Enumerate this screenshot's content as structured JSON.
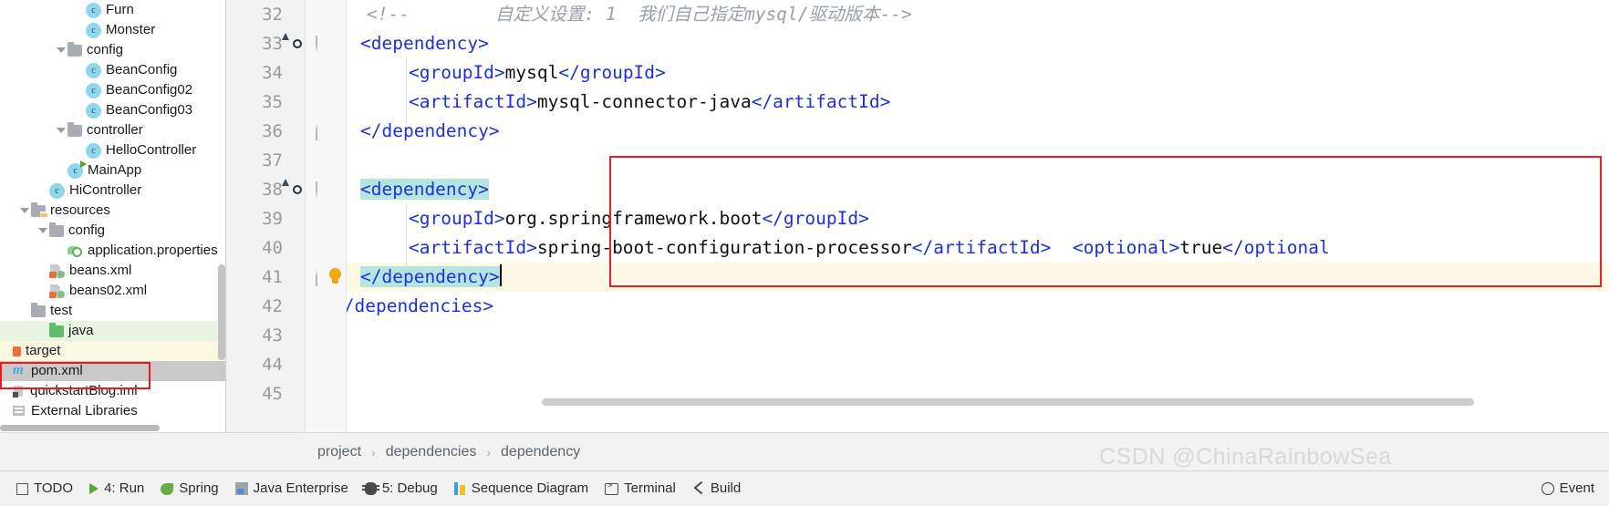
{
  "sidebar": {
    "items": [
      {
        "label": "Furn",
        "icon": "class-icon",
        "depth": 4,
        "row_bg": "none",
        "arrow": false
      },
      {
        "label": "Monster",
        "icon": "class-icon",
        "depth": 4,
        "row_bg": "none",
        "arrow": false
      },
      {
        "label": "config",
        "icon": "folder-icon",
        "depth": 3,
        "row_bg": "none",
        "arrow": true
      },
      {
        "label": "BeanConfig",
        "icon": "class-icon",
        "depth": 4,
        "row_bg": "none",
        "arrow": false
      },
      {
        "label": "BeanConfig02",
        "icon": "class-icon",
        "depth": 4,
        "row_bg": "none",
        "arrow": false
      },
      {
        "label": "BeanConfig03",
        "icon": "class-icon",
        "depth": 4,
        "row_bg": "none",
        "arrow": false
      },
      {
        "label": "controller",
        "icon": "folder-icon",
        "depth": 3,
        "row_bg": "none",
        "arrow": true
      },
      {
        "label": "HelloController",
        "icon": "class-icon",
        "depth": 4,
        "row_bg": "none",
        "arrow": false
      },
      {
        "label": "MainApp",
        "icon": "class-run-icon",
        "depth": 3,
        "row_bg": "none",
        "arrow": false
      },
      {
        "label": "HiController",
        "icon": "class-icon",
        "depth": 2,
        "row_bg": "none",
        "arrow": false
      },
      {
        "label": "resources",
        "icon": "resources-folder-icon",
        "depth": 1,
        "row_bg": "none",
        "arrow": true
      },
      {
        "label": "config",
        "icon": "folder-icon",
        "depth": 2,
        "row_bg": "none",
        "arrow": true
      },
      {
        "label": "application.properties",
        "icon": "properties-icon",
        "depth": 3,
        "row_bg": "none",
        "arrow": false
      },
      {
        "label": "beans.xml",
        "icon": "spring-xml-icon",
        "depth": 2,
        "row_bg": "none",
        "arrow": false
      },
      {
        "label": "beans02.xml",
        "icon": "spring-xml-icon",
        "depth": 2,
        "row_bg": "none",
        "arrow": false
      },
      {
        "label": "test",
        "icon": "folder-icon",
        "depth": 1,
        "row_bg": "none",
        "arrow": false
      },
      {
        "label": "java",
        "icon": "source-folder-icon",
        "depth": 2,
        "row_bg": "green",
        "arrow": false
      },
      {
        "label": "target",
        "icon": "target-folder-icon",
        "depth": 0,
        "row_bg": "yellow",
        "arrow": false
      },
      {
        "label": "pom.xml",
        "icon": "maven-icon",
        "depth": 0,
        "row_bg": "grey",
        "arrow": false
      },
      {
        "label": "quickstartBlog.iml",
        "icon": "iml-icon",
        "depth": 0,
        "row_bg": "none",
        "arrow": false
      },
      {
        "label": "External Libraries",
        "icon": "library-icon",
        "depth": 0,
        "row_bg": "none",
        "arrow": false
      }
    ]
  },
  "editor": {
    "line_numbers": [
      "32",
      "33",
      "34",
      "35",
      "36",
      "37",
      "38",
      "39",
      "40",
      "41",
      "42",
      "43",
      "44",
      "45"
    ],
    "lines": [
      {
        "num": "32",
        "indent": 0,
        "tokens": [
          {
            "t": "<!--        自定义设置: 1  我们自己指定mysql/驱动版本-->",
            "c": "cmt"
          }
        ]
      },
      {
        "num": "33",
        "indent": 0,
        "tokens": [
          {
            "t": "<dependency>",
            "c": "tag"
          }
        ]
      },
      {
        "num": "34",
        "indent": 1,
        "tokens": [
          {
            "t": "<groupId>",
            "c": "tag"
          },
          {
            "t": "mysql",
            "c": "text"
          },
          {
            "t": "</groupId>",
            "c": "tag"
          }
        ]
      },
      {
        "num": "35",
        "indent": 1,
        "tokens": [
          {
            "t": "<artifactId>",
            "c": "tag"
          },
          {
            "t": "mysql-connector-java",
            "c": "text"
          },
          {
            "t": "</artifactId>",
            "c": "tag"
          }
        ]
      },
      {
        "num": "36",
        "indent": 0,
        "tokens": [
          {
            "t": "</dependency>",
            "c": "tag"
          }
        ]
      },
      {
        "num": "37",
        "indent": 0,
        "tokens": []
      },
      {
        "num": "38",
        "indent": 0,
        "tokens": [
          {
            "t": "<dependency>",
            "c": "tag",
            "sel": true
          }
        ]
      },
      {
        "num": "39",
        "indent": 1,
        "tokens": [
          {
            "t": "<groupId>",
            "c": "tag"
          },
          {
            "t": "org.springframework.boot",
            "c": "text"
          },
          {
            "t": "</groupId>",
            "c": "tag"
          }
        ]
      },
      {
        "num": "40",
        "indent": 1,
        "tokens": [
          {
            "t": "<artifactId>",
            "c": "tag"
          },
          {
            "t": "spring-boot-configuration-processor",
            "c": "text"
          },
          {
            "t": "</artifactId>",
            "c": "tag"
          },
          {
            "t": "  ",
            "c": "text"
          },
          {
            "t": "<optional>",
            "c": "tag"
          },
          {
            "t": "true",
            "c": "text"
          },
          {
            "t": "</optional",
            "c": "tag"
          }
        ]
      },
      {
        "num": "41",
        "indent": 0,
        "tokens": [
          {
            "t": "</dependency>",
            "c": "tag",
            "sel": true
          }
        ],
        "caret": true,
        "highlighted": true
      },
      {
        "num": "42",
        "indent": 0,
        "tokens": [
          {
            "t": "</dependencies>",
            "c": "tag"
          }
        ],
        "outdent": true
      },
      {
        "num": "43",
        "indent": 0,
        "tokens": []
      },
      {
        "num": "44",
        "indent": 0,
        "tokens": []
      },
      {
        "num": "45",
        "indent": 0,
        "tokens": []
      }
    ],
    "gutter_icons": [
      {
        "line": "33",
        "icon": "maven-dependency-icon"
      },
      {
        "line": "38",
        "icon": "maven-dependency-icon"
      },
      {
        "line": "41",
        "icon": "intention-bulb-icon"
      }
    ],
    "fold_markers": [
      {
        "line": "33",
        "dir": "down"
      },
      {
        "line": "36",
        "dir": "up"
      },
      {
        "line": "38",
        "dir": "down"
      },
      {
        "line": "41",
        "dir": "up"
      }
    ]
  },
  "breadcrumb": {
    "separator": "›",
    "items": [
      "project",
      "dependencies",
      "dependency"
    ]
  },
  "watermark": {
    "text": "CSDN @ChinaRainbowSea"
  },
  "bottombar": {
    "items": [
      {
        "label": "TODO",
        "icon": "todo-icon"
      },
      {
        "label": "4: Run",
        "icon": "run-icon"
      },
      {
        "label": "Spring",
        "icon": "spring-icon"
      },
      {
        "label": "Java Enterprise",
        "icon": "java-enterprise-icon"
      },
      {
        "label": "5: Debug",
        "icon": "debug-icon"
      },
      {
        "label": "Sequence Diagram",
        "icon": "sequence-diagram-icon"
      },
      {
        "label": "Terminal",
        "icon": "terminal-icon"
      },
      {
        "label": "Build",
        "icon": "build-icon"
      }
    ],
    "right": {
      "label": "Event",
      "icon": "event-log-icon"
    }
  },
  "colors": {
    "tag": "#1f31d6",
    "text": "#111111",
    "comment": "#9aa0a8",
    "selection": "#b4e5e0",
    "current_line": "#fdf9e4",
    "annotation_red": "#ee1c24",
    "row_green": "#e8f5e0",
    "row_yellow": "#fbf8e2",
    "row_grey": "#c9c9c9"
  }
}
